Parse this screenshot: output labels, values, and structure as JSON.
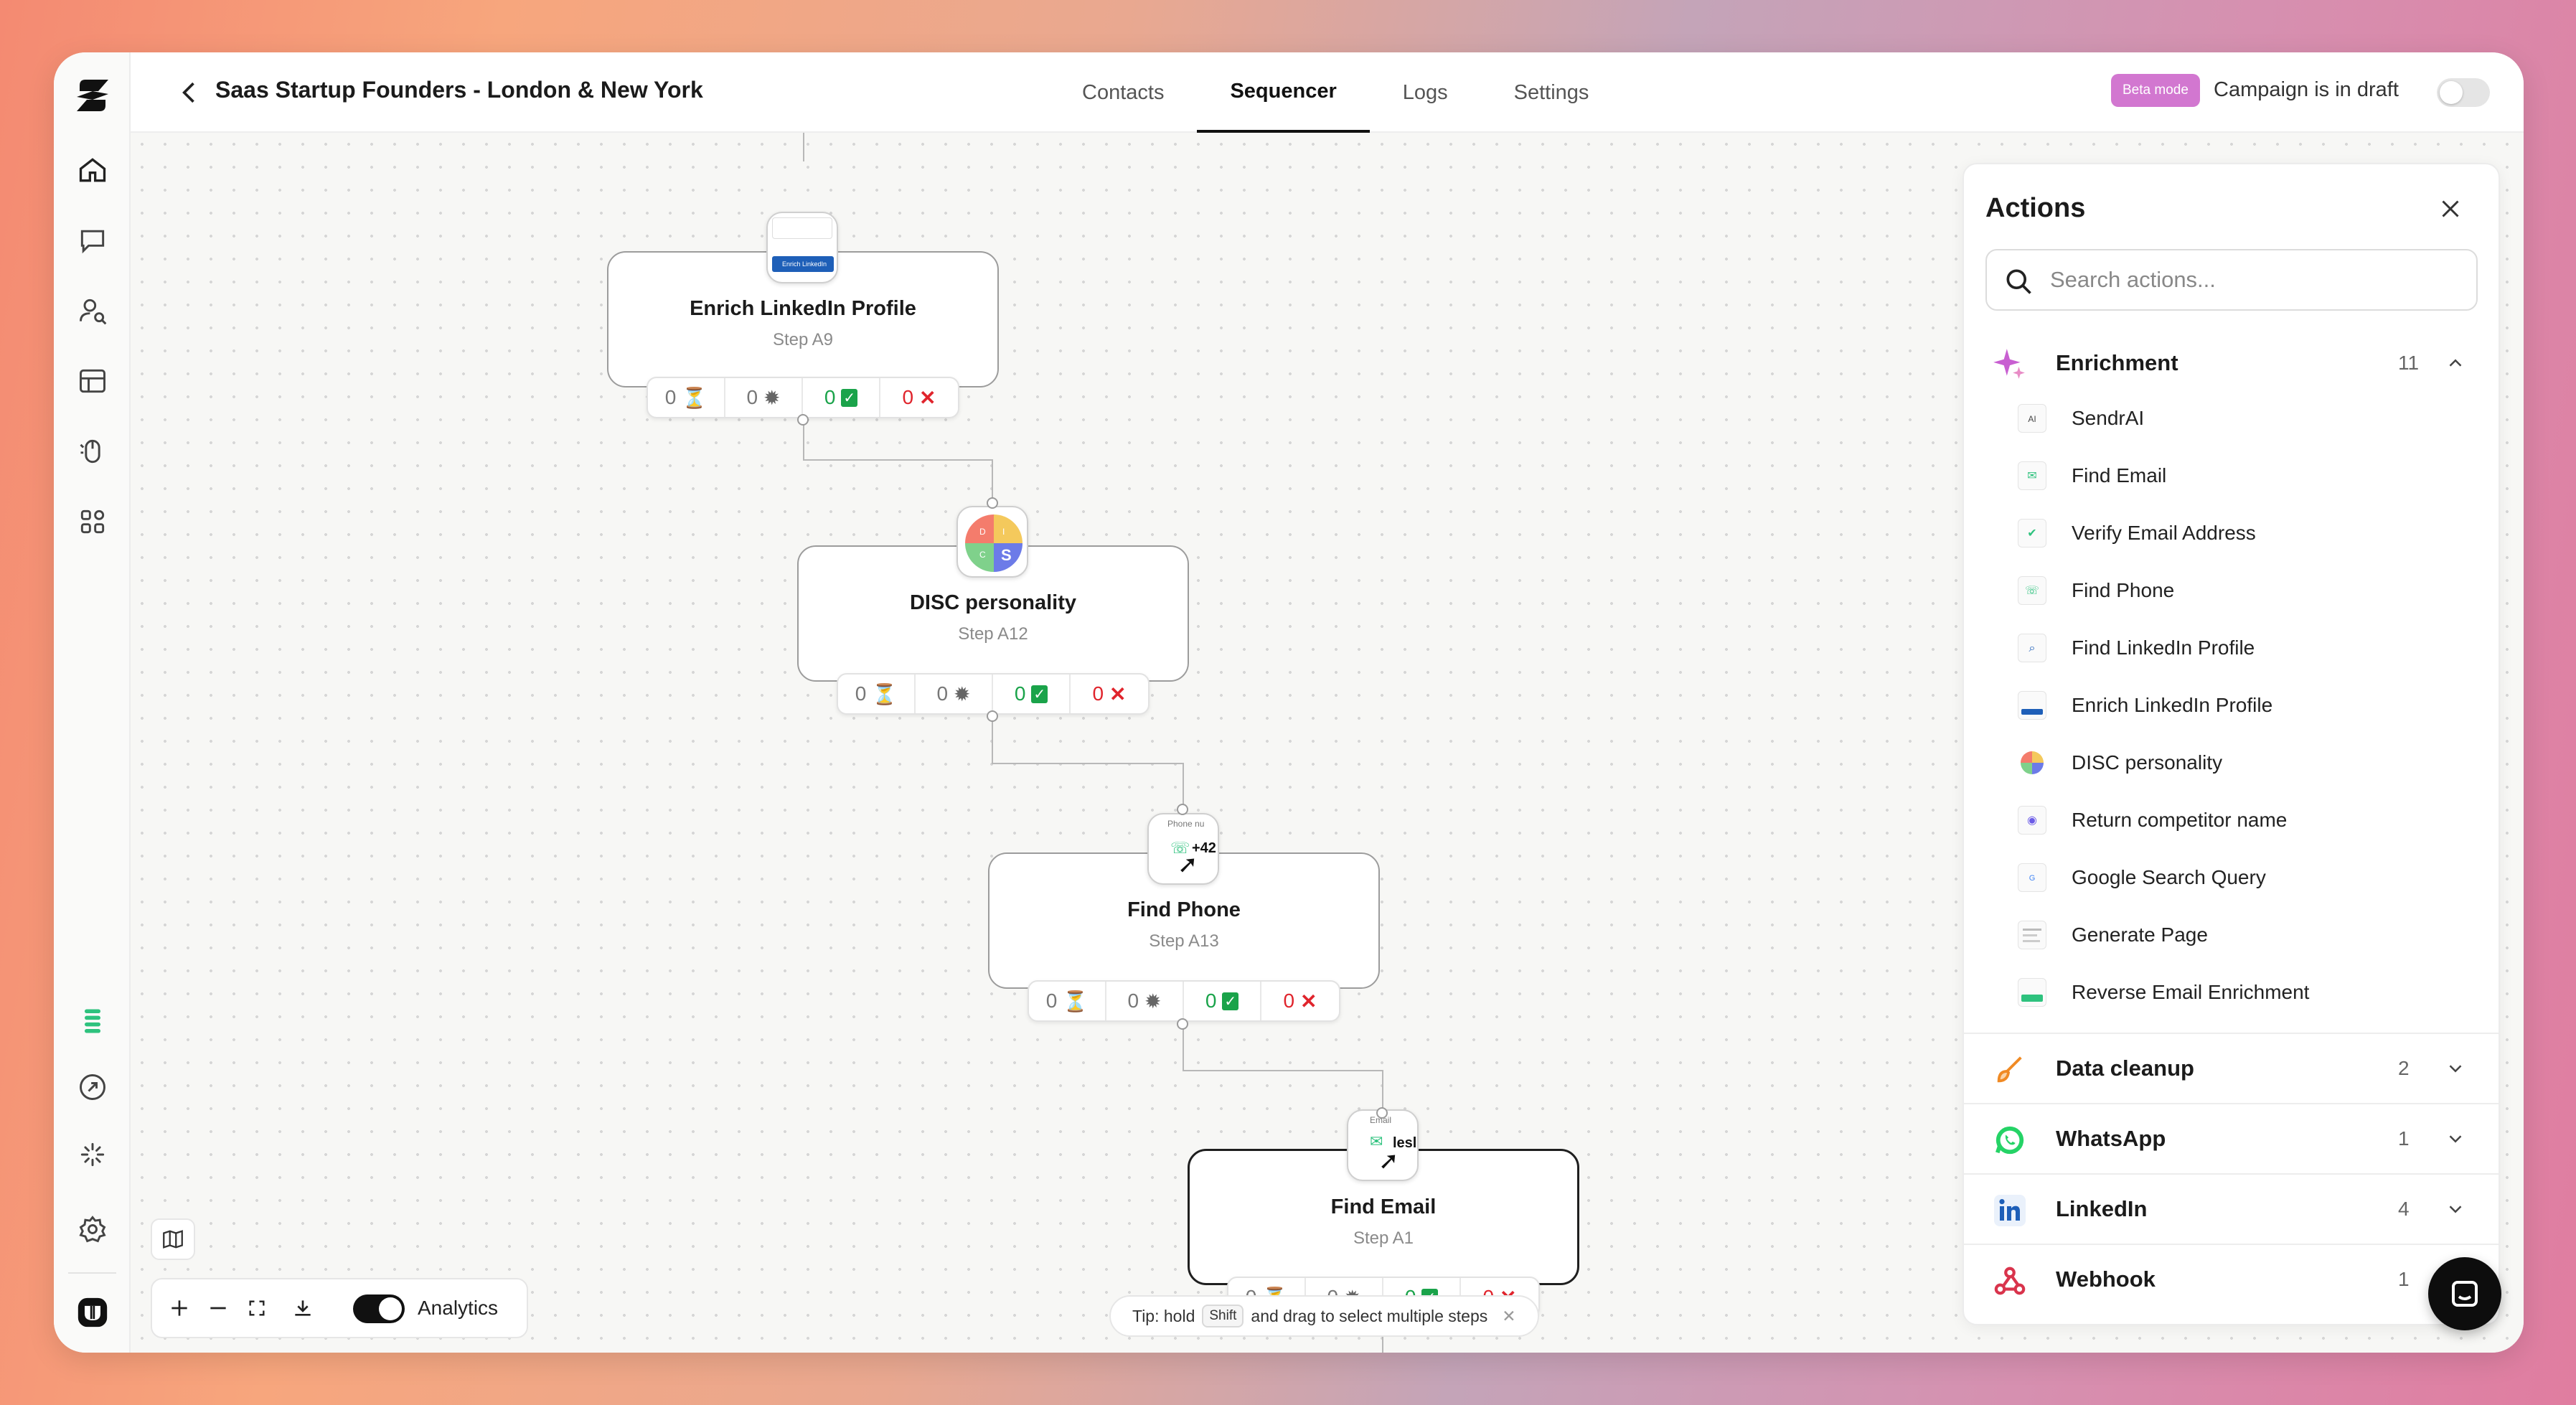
{
  "header": {
    "title": "Saas Startup Founders - London & New York",
    "tabs": [
      "Contacts",
      "Sequencer",
      "Logs",
      "Settings"
    ],
    "beta_badge": "Beta mode",
    "draft_status": "Campaign is in draft"
  },
  "nodes": [
    {
      "title": "Enrich LinkedIn Profile",
      "step": "Step A9",
      "stats": [
        "0",
        "0",
        "0",
        "0"
      ]
    },
    {
      "title": "DISC personality",
      "step": "Step A12",
      "stats": [
        "0",
        "0",
        "0",
        "0"
      ]
    },
    {
      "title": "Find Phone",
      "step": "Step A13",
      "stats": [
        "0",
        "0",
        "0",
        "0"
      ]
    },
    {
      "title": "Find Email",
      "step": "Step A1",
      "stats": [
        "0",
        "0",
        "0",
        "0"
      ]
    }
  ],
  "node_icon_text": {
    "phone_label": "Phone nu",
    "phone_value": "+42",
    "email_label": "Email",
    "email_value": "lesl",
    "disc_letters": [
      "D",
      "I",
      "S",
      "C"
    ],
    "linkedin_mini": "Enrich LinkedIn"
  },
  "panel": {
    "title": "Actions",
    "search_placeholder": "Search actions...",
    "enrichment": {
      "label": "Enrichment",
      "count": "11",
      "items": [
        "SendrAI",
        "Find Email",
        "Verify Email Address",
        "Find Phone",
        "Find LinkedIn Profile",
        "Enrich LinkedIn Profile",
        "DISC personality",
        "Return competitor name",
        "Google Search Query",
        "Generate Page",
        "Reverse Email Enrichment"
      ]
    },
    "sections": [
      {
        "label": "Data cleanup",
        "count": "2"
      },
      {
        "label": "WhatsApp",
        "count": "1"
      },
      {
        "label": "LinkedIn",
        "count": "4"
      },
      {
        "label": "Webhook",
        "count": "1"
      }
    ]
  },
  "toolbar": {
    "analytics_label": "Analytics"
  },
  "tip": {
    "prefix": "Tip: hold",
    "key": "Shift",
    "suffix": "and drag to select multiple steps"
  },
  "colors": {
    "accent": "#d277d0",
    "success": "#1aa34a",
    "error": "#e0242c",
    "rail_green": "#2ec27e"
  }
}
